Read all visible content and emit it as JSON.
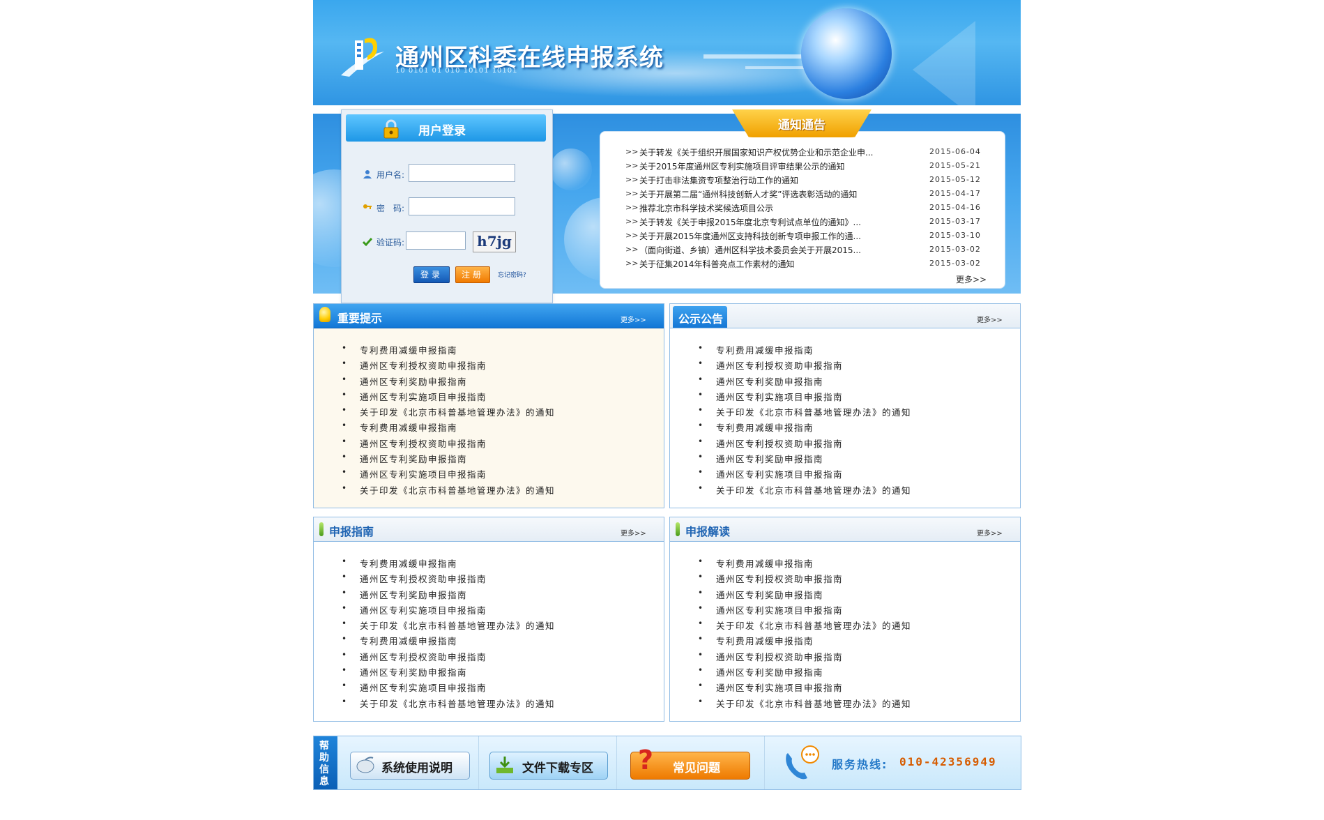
{
  "header": {
    "title": "通州区科委在线申报系统",
    "binary_text": "10 0101 01 010 10101 10101"
  },
  "login": {
    "title": "用户登录",
    "username_label": "用户名:",
    "username_value": "",
    "password_label": "密　码:",
    "password_value": "",
    "captcha_label": "验证码:",
    "captcha_value": "",
    "captcha_image_text": "h7jg",
    "login_button": "登录",
    "register_button": "注册",
    "forgot_link": "忘记密码?"
  },
  "notice": {
    "title": "通知通告",
    "more": "更多>>",
    "items": [
      {
        "text": "关于转发《关于组织开展国家知识产权优势企业和示范企业申...",
        "date": "2015-06-04"
      },
      {
        "text": "关于2015年度通州区专利实施项目评审结果公示的通知",
        "date": "2015-05-21"
      },
      {
        "text": "关于打击非法集资专项整治行动工作的通知",
        "date": "2015-05-12"
      },
      {
        "text": "关于开展第二届“通州科技创新人才奖”评选表彰活动的通知",
        "date": "2015-04-17"
      },
      {
        "text": "推荐北京市科学技术奖候选项目公示",
        "date": "2015-04-16"
      },
      {
        "text": "关于转发《关于申报2015年度北京专利试点单位的通知》...",
        "date": "2015-03-17"
      },
      {
        "text": "关于开展2015年度通州区支持科技创新专项申报工作的通...",
        "date": "2015-03-10"
      },
      {
        "text": "（面向街道、乡镇）通州区科学技术委员会关于开展2015...",
        "date": "2015-03-02"
      },
      {
        "text": "关于征集2014年科普亮点工作素材的通知",
        "date": "2015-03-02"
      }
    ]
  },
  "panels": {
    "important": {
      "title": "重要提示",
      "more": "更多>>",
      "items": [
        "专利费用减缓申报指南",
        "通州区专利授权资助申报指南",
        "通州区专利奖励申报指南",
        "通州区专利实施项目申报指南",
        "关于印发《北京市科普基地管理办法》的通知",
        "专利费用减缓申报指南",
        "通州区专利授权资助申报指南",
        "通州区专利奖励申报指南",
        "通州区专利实施项目申报指南",
        "关于印发《北京市科普基地管理办法》的通知"
      ]
    },
    "announce": {
      "title": "公示公告",
      "more": "更多>>",
      "items": [
        "专利费用减缓申报指南",
        "通州区专利授权资助申报指南",
        "通州区专利奖励申报指南",
        "通州区专利实施项目申报指南",
        "关于印发《北京市科普基地管理办法》的通知",
        "专利费用减缓申报指南",
        "通州区专利授权资助申报指南",
        "通州区专利奖励申报指南",
        "通州区专利实施项目申报指南",
        "关于印发《北京市科普基地管理办法》的通知"
      ]
    },
    "guide": {
      "title": "申报指南",
      "more": "更多>>",
      "items": [
        "专利费用减缓申报指南",
        "通州区专利授权资助申报指南",
        "通州区专利奖励申报指南",
        "通州区专利实施项目申报指南",
        "关于印发《北京市科普基地管理办法》的通知",
        "专利费用减缓申报指南",
        "通州区专利授权资助申报指南",
        "通州区专利奖励申报指南",
        "通州区专利实施项目申报指南",
        "关于印发《北京市科普基地管理办法》的通知"
      ]
    },
    "interpret": {
      "title": "申报解读",
      "more": "更多>>",
      "items": [
        "专利费用减缓申报指南",
        "通州区专利授权资助申报指南",
        "通州区专利奖励申报指南",
        "通州区专利实施项目申报指南",
        "关于印发《北京市科普基地管理办法》的通知",
        "专利费用减缓申报指南",
        "通州区专利授权资助申报指南",
        "通州区专利奖励申报指南",
        "通州区专利实施项目申报指南",
        "关于印发《北京市科普基地管理办法》的通知"
      ]
    }
  },
  "help": {
    "side_label": "帮助信息",
    "manual": "系统使用说明",
    "download": "文件下载专区",
    "faq": "常见问题",
    "hotline_label": "服务热线:",
    "hotline_number": "010-42356949"
  },
  "colors": {
    "brand_blue": "#1f84da",
    "accent_orange": "#f07a00",
    "panel_border": "#8fbbe4"
  },
  "icons": {
    "logo": "building-logo-icon",
    "globe": "globe-icon",
    "lock": "lock-icon",
    "user": "user-icon",
    "key": "key-icon",
    "check": "check-icon",
    "bulb": "bulb-icon",
    "phone": "phone-icon"
  }
}
